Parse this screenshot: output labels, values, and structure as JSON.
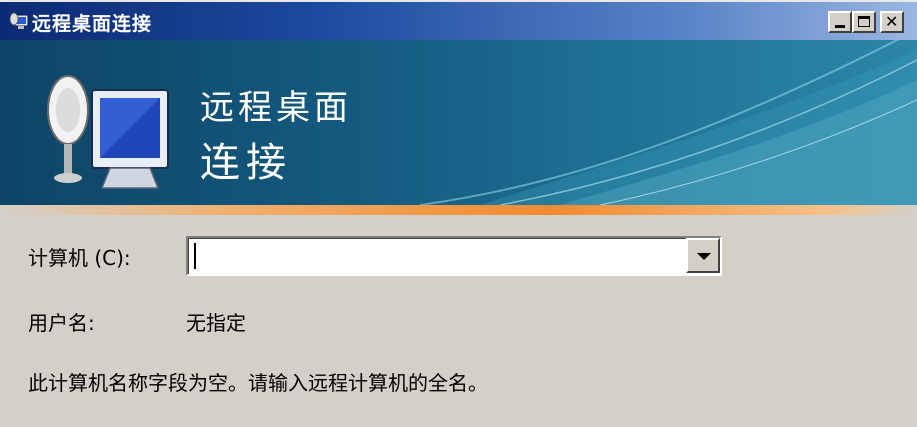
{
  "window": {
    "title": "远程桌面连接",
    "controls": {
      "minimize_icon": "minimize-icon",
      "maximize_icon": "maximize-icon",
      "close_icon": "close-icon"
    }
  },
  "banner": {
    "title_line1": "远程桌面",
    "title_line2": "连接",
    "icon": "remote-desktop-monitor-icon"
  },
  "form": {
    "computer_label": "计算机 (C):",
    "computer_value": "",
    "username_label": "用户名:",
    "username_value": "无指定",
    "message": "此计算机名称字段为空。请输入远程计算机的全名。"
  },
  "colors": {
    "titlebar_start": "#0b2a73",
    "banner": "#145b80",
    "accent_orange": "#f08a30",
    "window_bg": "#d4d0c8"
  }
}
